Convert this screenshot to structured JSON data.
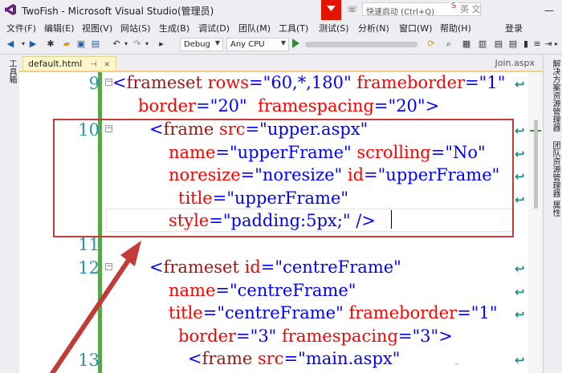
{
  "titlebar": {
    "title": "TwoFish - Microsoft Visual Studio(管理员)",
    "quick_launch_placeholder": "快速启动 (Ctrl+Q)",
    "ime_badge": "S",
    "ime_text": "英 文",
    "minimize": "—",
    "restore": "❐",
    "close": "✕"
  },
  "menu": {
    "items": [
      "文件(F)",
      "编辑(E)",
      "视图(V)",
      "网站(S)",
      "生成(B)",
      "调试(D)",
      "团队(M)",
      "工具(T)",
      "测试(S)",
      "分析(N)",
      "窗口(W)",
      "帮助(H)"
    ],
    "login": "登录"
  },
  "toolbar": {
    "configuration": "Debug",
    "platform": "Any CPU"
  },
  "left_strip": {
    "label": "工具箱"
  },
  "right_strip": {
    "labels": [
      "解决方案资源管理器",
      "团队资源管理器",
      "属性"
    ]
  },
  "tabs": {
    "active": "default.html",
    "pin": "⊣",
    "close": "×",
    "other": "Join.aspx"
  },
  "editor": {
    "line_numbers": [
      "9",
      "10",
      "11",
      "12",
      "13"
    ],
    "accent_color": "#57a64a",
    "lines": [
      [
        {
          "c": "b",
          "t": "<"
        },
        {
          "c": "t",
          "t": "frameset"
        },
        {
          "c": "",
          "t": " "
        },
        {
          "c": "a",
          "t": "rows"
        },
        {
          "c": "b",
          "t": "="
        },
        {
          "c": "v",
          "t": "\"60,*,180\""
        },
        {
          "c": "",
          "t": " "
        },
        {
          "c": "a",
          "t": "frameborder"
        },
        {
          "c": "b",
          "t": "="
        },
        {
          "c": "v",
          "t": "\"1\""
        }
      ],
      [
        {
          "c": "a",
          "t": "border"
        },
        {
          "c": "b",
          "t": "="
        },
        {
          "c": "v",
          "t": "\"20\""
        },
        {
          "c": "",
          "t": "  "
        },
        {
          "c": "a",
          "t": "framespacing"
        },
        {
          "c": "b",
          "t": "="
        },
        {
          "c": "v",
          "t": "\"20\""
        },
        {
          "c": "b",
          "t": ">"
        }
      ],
      [
        {
          "c": "b",
          "t": "<"
        },
        {
          "c": "t",
          "t": "frame"
        },
        {
          "c": "",
          "t": " "
        },
        {
          "c": "a",
          "t": "src"
        },
        {
          "c": "b",
          "t": "="
        },
        {
          "c": "v",
          "t": "\"upper.aspx\""
        }
      ],
      [
        {
          "c": "a",
          "t": "name"
        },
        {
          "c": "b",
          "t": "="
        },
        {
          "c": "v",
          "t": "\"upperFrame\""
        },
        {
          "c": "",
          "t": " "
        },
        {
          "c": "a",
          "t": "scrolling"
        },
        {
          "c": "b",
          "t": "="
        },
        {
          "c": "v",
          "t": "\"No\""
        }
      ],
      [
        {
          "c": "a",
          "t": "noresize"
        },
        {
          "c": "b",
          "t": "="
        },
        {
          "c": "v",
          "t": "\"noresize\""
        },
        {
          "c": "",
          "t": " "
        },
        {
          "c": "a",
          "t": "id"
        },
        {
          "c": "b",
          "t": "="
        },
        {
          "c": "v",
          "t": "\"upperFrame\""
        }
      ],
      [
        {
          "c": "a",
          "t": "title"
        },
        {
          "c": "b",
          "t": "="
        },
        {
          "c": "v",
          "t": "\"upperFrame\""
        }
      ],
      [
        {
          "c": "a",
          "t": "style"
        },
        {
          "c": "b",
          "t": "="
        },
        {
          "c": "v",
          "t": "\"padding:5px;\""
        },
        {
          "c": "",
          "t": " "
        },
        {
          "c": "b",
          "t": "/>"
        }
      ],
      [
        {
          "c": "b",
          "t": "<"
        },
        {
          "c": "t",
          "t": "frameset"
        },
        {
          "c": "",
          "t": " "
        },
        {
          "c": "a",
          "t": "id"
        },
        {
          "c": "b",
          "t": "="
        },
        {
          "c": "v",
          "t": "\"centreFrame\""
        }
      ],
      [
        {
          "c": "a",
          "t": "name"
        },
        {
          "c": "b",
          "t": "="
        },
        {
          "c": "v",
          "t": "\"centreFrame\""
        }
      ],
      [
        {
          "c": "a",
          "t": "title"
        },
        {
          "c": "b",
          "t": "="
        },
        {
          "c": "v",
          "t": "\"centreFrame\""
        },
        {
          "c": "",
          "t": " "
        },
        {
          "c": "a",
          "t": "frameborder"
        },
        {
          "c": "b",
          "t": "="
        },
        {
          "c": "v",
          "t": "\"1\""
        }
      ],
      [
        {
          "c": "a",
          "t": "border"
        },
        {
          "c": "b",
          "t": "="
        },
        {
          "c": "v",
          "t": "\"3\""
        },
        {
          "c": "",
          "t": " "
        },
        {
          "c": "a",
          "t": "framespacing"
        },
        {
          "c": "b",
          "t": "="
        },
        {
          "c": "v",
          "t": "\"3\""
        },
        {
          "c": "b",
          "t": ">"
        }
      ],
      [
        {
          "c": "b",
          "t": "<"
        },
        {
          "c": "t",
          "t": "frame"
        },
        {
          "c": "",
          "t": " "
        },
        {
          "c": "a",
          "t": "src"
        },
        {
          "c": "b",
          "t": "="
        },
        {
          "c": "v",
          "t": "\"main.aspx\""
        }
      ]
    ],
    "wrap_glyph": "↩"
  },
  "annotation": {
    "color": "#c23a3a"
  }
}
